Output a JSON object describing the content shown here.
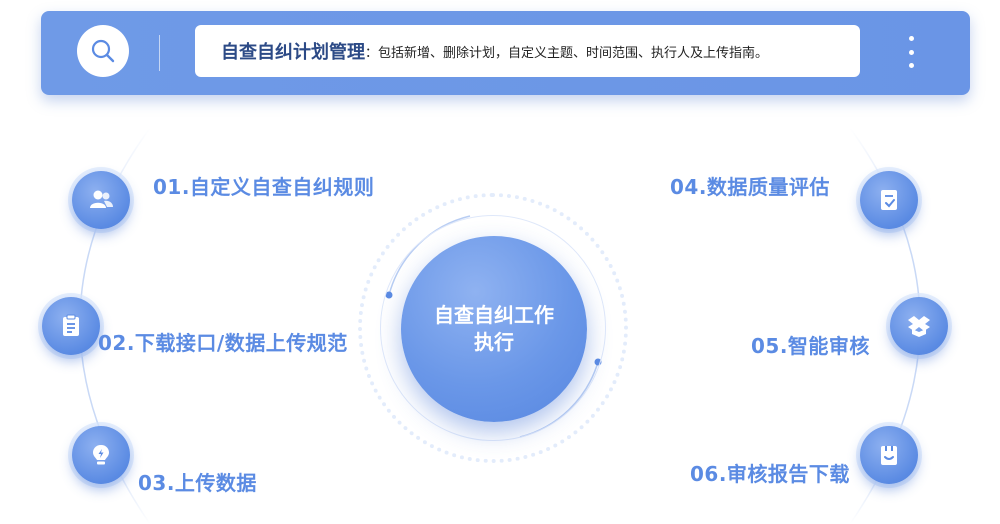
{
  "banner": {
    "title": "自查自纠计划管理",
    "colon": "：",
    "description": "包括新增、删除计划，自定义主题、时间范围、执行人及上传指南。",
    "icons": {
      "search": "search-icon",
      "menu": "more-vertical-icon"
    }
  },
  "center": {
    "line1": "自查自纠工作",
    "line2": "执行"
  },
  "steps": [
    {
      "label": "01.自定义自查自纠规则",
      "icon": "users-icon"
    },
    {
      "label": "02.下载接口/数据上传规范",
      "icon": "clipboard-icon"
    },
    {
      "label": "03.上传数据",
      "icon": "lightbulb-icon"
    },
    {
      "label": "04.数据质量评估",
      "icon": "checklist-icon"
    },
    {
      "label": "05.智能审核",
      "icon": "box-icon"
    },
    {
      "label": "06.审核报告下载",
      "icon": "report-icon"
    }
  ],
  "colors": {
    "accent": "#5b8be3",
    "banner": "#6f9ae7",
    "titleText": "#2c4a86"
  }
}
